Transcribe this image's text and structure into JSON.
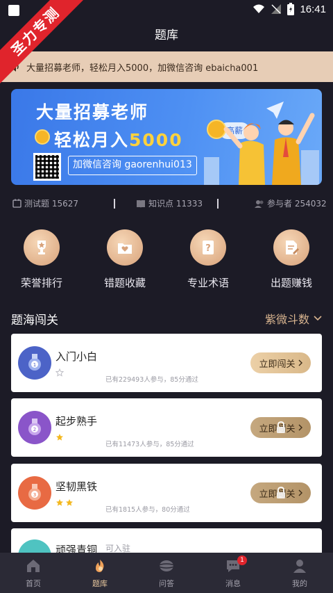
{
  "status_bar": {
    "time": "16:41"
  },
  "ribbon": {
    "text": "圣力专测"
  },
  "header": {
    "title": "题库"
  },
  "notice": {
    "text": "大量招募老师，轻松月入5000，加微信咨询 ebaicha001"
  },
  "banner": {
    "line1": "大量招募老师",
    "line2_prefix": "轻松月入",
    "line2_amount": "5000",
    "contact": "加微信咨询 gaorenhui013",
    "badge": "高薪"
  },
  "stats": [
    {
      "label": "测试题 15627"
    },
    {
      "label": "知识点 11333"
    },
    {
      "label": "参与者 254032"
    }
  ],
  "quick_entries": [
    {
      "label": "荣誉排行",
      "icon": "trophy-icon"
    },
    {
      "label": "错题收藏",
      "icon": "heart-folder-icon"
    },
    {
      "label": "专业术语",
      "icon": "question-book-icon"
    },
    {
      "label": "出题赚钱",
      "icon": "document-edit-icon"
    }
  ],
  "section": {
    "title": "题海闯关",
    "filter": "紫微斗数"
  },
  "levels": [
    {
      "name": "入门小白",
      "stars": 0,
      "meta": "已有229493人参与，85分通过",
      "button": "立即闯关",
      "locked": false,
      "color": "#4c63c7"
    },
    {
      "name": "起步熟手",
      "stars": 1,
      "meta": "已有11473人参与，85分通过",
      "button": "立即闯关",
      "locked": true,
      "color": "#8a55c9"
    },
    {
      "name": "坚韧黑铁",
      "stars": 2,
      "meta": "已有1815人参与，80分通过",
      "button": "立即闯关",
      "locked": true,
      "color": "#e86a43"
    },
    {
      "name": "顽强青铜",
      "extra": "可入驻",
      "color": "#4fc3c1"
    }
  ],
  "bottom_nav": [
    {
      "label": "首页",
      "icon": "home-icon",
      "active": false
    },
    {
      "label": "题库",
      "icon": "question-bank-icon",
      "active": true
    },
    {
      "label": "问答",
      "icon": "qa-icon",
      "active": false
    },
    {
      "label": "消息",
      "icon": "message-icon",
      "active": false,
      "badge": "1"
    },
    {
      "label": "我的",
      "icon": "profile-icon",
      "active": false
    }
  ],
  "colors": {
    "background": "#1c1b26",
    "accent_gold": "#d8b48f",
    "notice_bg": "#e7cdb6",
    "banner_blue": "#3a78e8"
  }
}
